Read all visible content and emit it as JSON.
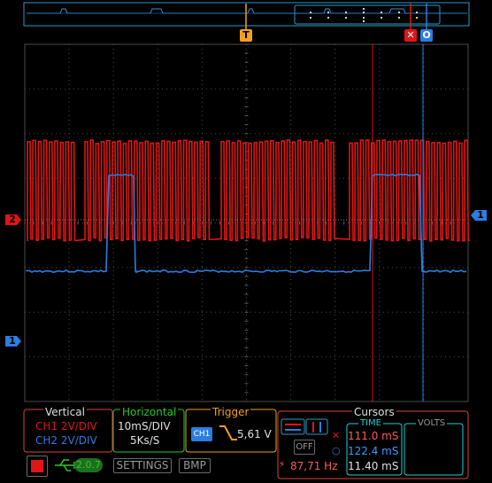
{
  "markers": {
    "trigger_pos": "T",
    "cursor_a": "✕",
    "cursor_b": "O",
    "ch2_marker": "2",
    "ch1_marker": "1",
    "ch1_level": "1"
  },
  "vertical": {
    "title": "Vertical",
    "ch1": "CH1 2V/DIV",
    "ch2": "CH2 2V/DIV"
  },
  "horizontal": {
    "title": "Horizontal",
    "timebase": "10mS/DIV",
    "sample_rate": "5Ks/S"
  },
  "trigger": {
    "title": "Trigger",
    "source": "CH1",
    "level": "5,61 V"
  },
  "cursors": {
    "title": "Cursors",
    "mode": "OFF",
    "frequency": "87,71 Hz",
    "time_title": "TIME",
    "time_a": "111.0 mS",
    "time_b": "122.4 mS",
    "time_delta": "11.40 mS",
    "volts_title": "VOLTS",
    "a_symbol": "✕",
    "b_symbol": "○",
    "freq_symbol": "⚡"
  },
  "bottom": {
    "version": "2.0.7",
    "settings": "SETTINGS",
    "bmp": "BMP"
  },
  "colors": {
    "ch1": "#2a7de1",
    "ch2": "#e01515",
    "trigger": "#f5a020",
    "grid": "#4c4c4c",
    "horizontal": "#2aca2a",
    "cursors": "#ff5a5a",
    "time": "#20d0d0"
  }
}
